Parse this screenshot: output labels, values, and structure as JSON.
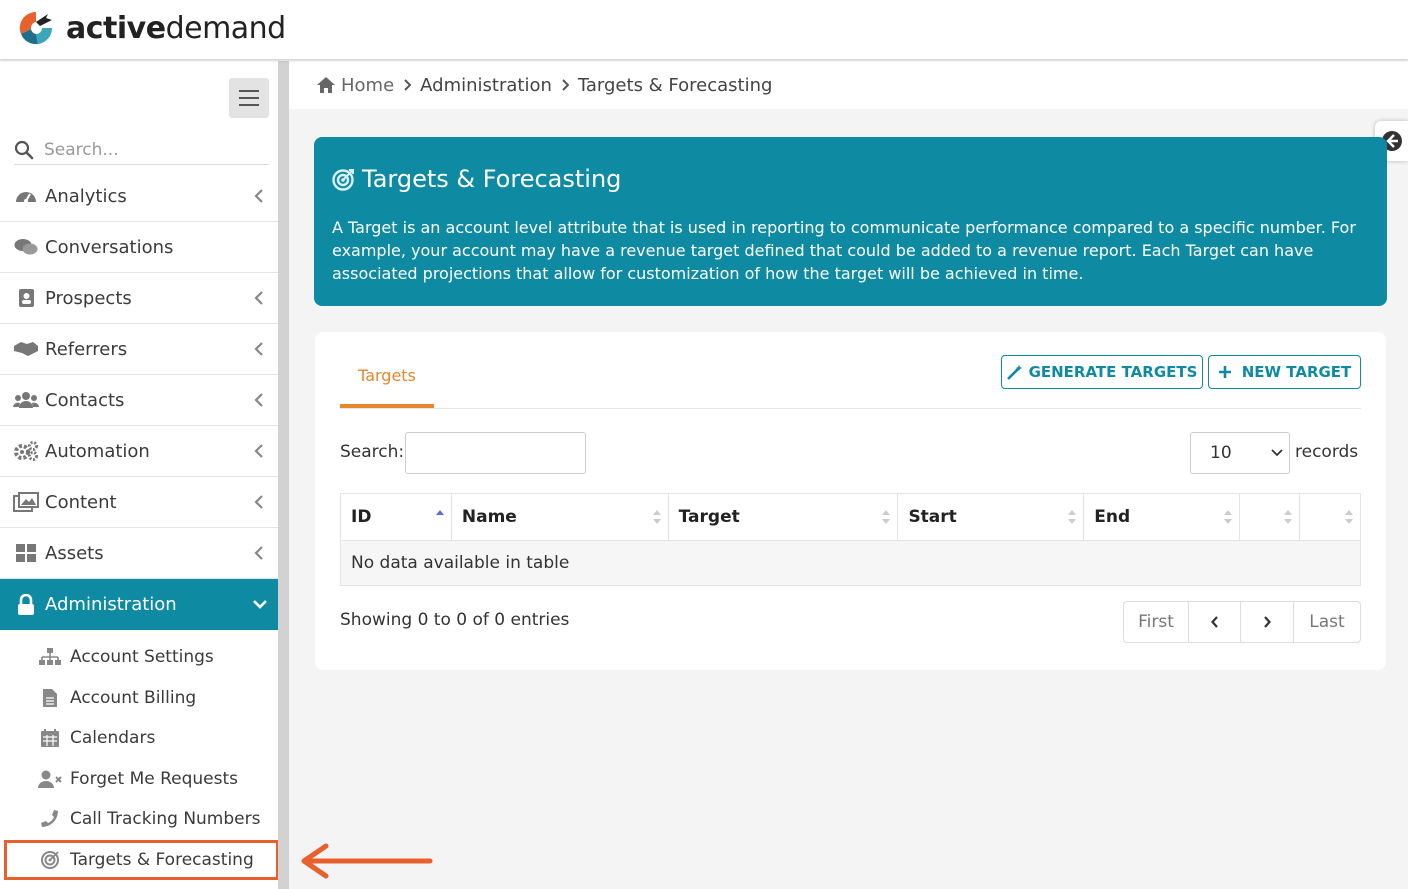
{
  "app": {
    "logo_bold": "active",
    "logo_light": "demand",
    "brand_color": "#0e8aa3",
    "accent_color": "#e8862c",
    "annotation_color": "#e8612c"
  },
  "sidebar": {
    "search_placeholder": "Search...",
    "items": [
      {
        "label": "Analytics",
        "icon": "dashboard-icon",
        "has_chevron": true
      },
      {
        "label": "Conversations",
        "icon": "comments-icon",
        "has_chevron": false
      },
      {
        "label": "Prospects",
        "icon": "address-book-icon",
        "has_chevron": true
      },
      {
        "label": "Referrers",
        "icon": "handshake-icon",
        "has_chevron": true
      },
      {
        "label": "Contacts",
        "icon": "users-icon",
        "has_chevron": true
      },
      {
        "label": "Automation",
        "icon": "cogs-icon",
        "has_chevron": true
      },
      {
        "label": "Content",
        "icon": "image-icon",
        "has_chevron": true
      },
      {
        "label": "Assets",
        "icon": "grid-icon",
        "has_chevron": true
      },
      {
        "label": "Administration",
        "icon": "lock-icon",
        "has_chevron": true,
        "active": true
      }
    ],
    "subitems": [
      {
        "label": "Account Settings",
        "icon": "sitemap-icon"
      },
      {
        "label": "Account Billing",
        "icon": "file-icon"
      },
      {
        "label": "Calendars",
        "icon": "calendar-icon"
      },
      {
        "label": "Forget Me Requests",
        "icon": "user-times-icon"
      },
      {
        "label": "Call Tracking Numbers",
        "icon": "phone-icon"
      },
      {
        "label": "Targets & Forecasting",
        "icon": "bullseye-icon",
        "highlighted": true
      }
    ]
  },
  "breadcrumb": {
    "home": "Home",
    "level1": "Administration",
    "level2": "Targets & Forecasting"
  },
  "hero": {
    "title": "Targets & Forecasting",
    "description": "A Target is an account level attribute that is used in reporting to communicate performance compared to a specific number. For example, your account may have a revenue target defined that could be added to a revenue report. Each Target can have associated projections that allow for customization of how the target will be achieved in time."
  },
  "card": {
    "tab_label": "Targets",
    "generate_button": "GENERATE TARGETS",
    "new_button": "NEW TARGET",
    "search_label": "Search:",
    "search_value": "",
    "page_length": "10",
    "records_label": "records",
    "table": {
      "columns": [
        "ID",
        "Name",
        "Target",
        "Start",
        "End",
        "",
        ""
      ],
      "empty_message": "No data available in table"
    },
    "info": "Showing 0 to 0 of 0 entries",
    "pager": {
      "first": "First",
      "last": "Last"
    }
  }
}
